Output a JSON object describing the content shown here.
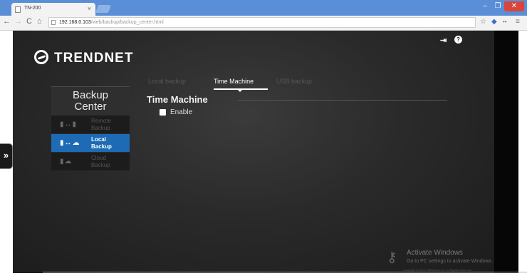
{
  "browser": {
    "tab_title": "TN-200",
    "tab_close": "×",
    "url_host": "192.168.0.103",
    "url_path": "/web/backup/backup_center.html",
    "window_buttons": {
      "minimize": "–",
      "maximize": "❐",
      "close": "✕"
    },
    "nav": {
      "back": "←",
      "forward": "→",
      "reload": "C",
      "home": "⌂"
    },
    "toolbar_icons": {
      "star": "☆",
      "ext1": "◆",
      "ext2": "••",
      "menu": "≡"
    }
  },
  "page": {
    "logo_text": "TRENDNET",
    "top_icons": {
      "logout": "⇥",
      "help": "?"
    },
    "panel": {
      "title_line1": "Backup",
      "title_line2": "Center",
      "items": [
        {
          "label_line1": "Remote",
          "label_line2": "Backup",
          "icon": "▮↔▮",
          "active": false
        },
        {
          "label_line1": "Local",
          "label_line2": "Backup",
          "icon": "▮↔☁",
          "active": true
        },
        {
          "label_line1": "Cloud",
          "label_line2": "Backup",
          "icon": "▮☁",
          "active": false
        }
      ]
    },
    "side_toggle": "»",
    "tabs": [
      "Local backup",
      "Time Machine",
      "USB backup"
    ],
    "active_tab": "Time Machine",
    "section_title": "Time Machine",
    "enable_label": "Enable",
    "enable_checked": false,
    "watermark": {
      "title": "Activate Windows",
      "subtitle": "Go to PC settings to activate Windows."
    },
    "copyright": "Copyright © 2013 TRENDnet Inc. All Rights Reserved."
  },
  "colors": {
    "accent": "#1e6bb5",
    "tabstrip": "#5a8fd8",
    "page_bg": "#2a2a2a"
  }
}
